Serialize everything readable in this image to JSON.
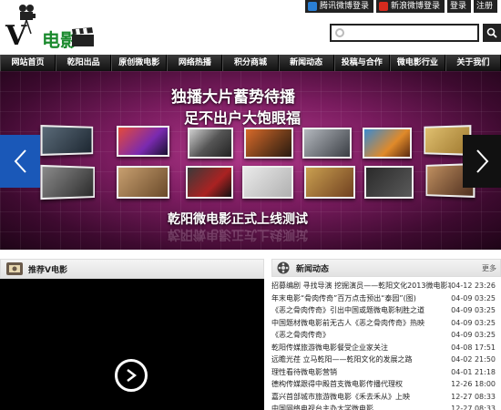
{
  "header": {
    "logo_letter": "V",
    "logo_text": "电影"
  },
  "toplinks": [
    {
      "label": "腾讯微博登录",
      "icon": "tencent-weibo-icon",
      "color": "#2a7fd4"
    },
    {
      "label": "新浪微博登录",
      "icon": "sina-weibo-icon",
      "color": "#d52b1e"
    },
    {
      "label": "登录"
    },
    {
      "label": "注册"
    }
  ],
  "search": {
    "placeholder": "",
    "value": ""
  },
  "nav": [
    "网站首页",
    "乾阳出品",
    "原创微电影",
    "网络热播",
    "积分商城",
    "新闻动态",
    "投稿与合作",
    "微电影行业",
    "关于我们"
  ],
  "banner": {
    "slogan_1": "独播大片蓄势待播",
    "slogan_2": "足不出户大饱眼福",
    "slogan_3": "乾阳微电影正式上线测试"
  },
  "left_panel": {
    "title": "推荐V电影"
  },
  "right_panel": {
    "title": "新闻动态",
    "more": "更多",
    "items": [
      {
        "title": "招募编剧 寻找导演 挖掘演员——乾阳文化2013微电影事总动员",
        "date": "04-12 23:26"
      },
      {
        "title": "年末电影“骨肉传奇”百万点击预出“泰园”(图)",
        "date": "04-09 03:25"
      },
      {
        "title": "《恶之骨肉传奇》引出中国或题微电影制胜之道",
        "date": "04-09 03:25"
      },
      {
        "title": "中国题材微电影前无古人《恶之骨肉传奇》热映",
        "date": "04-09 03:25"
      },
      {
        "title": "《恶之骨肉传奇》",
        "date": "04-09 03:25"
      },
      {
        "title": "乾阳传媒旅游微电影餐受企业家关注",
        "date": "04-08 17:51"
      },
      {
        "title": "远瞻光荏 立马乾阳——乾阳文化的发展之路",
        "date": "04-02 21:50"
      },
      {
        "title": "理性看待微电影营销",
        "date": "04-01 21:18"
      },
      {
        "title": "德构传媒跟得中殿首支微电影传播代理权",
        "date": "12-26 18:00"
      },
      {
        "title": "嘉兴首部城市旅游微电影《禾去禾从》上映",
        "date": "12-27 08:33"
      },
      {
        "title": "中国网络电视台主办大学微电影",
        "date": "12-27 08:33"
      }
    ]
  }
}
